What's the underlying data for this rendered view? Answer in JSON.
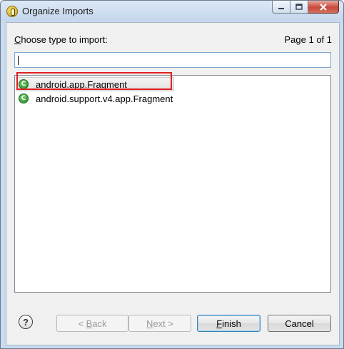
{
  "window": {
    "title": "Organize Imports",
    "controls": {
      "minimize_icon": "window-minimize-icon",
      "maximize_icon": "window-maximize-icon",
      "close_icon": "window-close-icon"
    }
  },
  "dialog": {
    "prompt_mnemonic": "C",
    "prompt_rest": "hoose type to import:",
    "page_indicator": "Page 1 of 1",
    "filter": {
      "value": "",
      "placeholder": ""
    }
  },
  "types": [
    {
      "label": "android.app.Fragment",
      "icon": "class-icon",
      "icon_glyph": "C",
      "selected": true
    },
    {
      "label": "android.support.v4.app.Fragment",
      "icon": "class-icon",
      "icon_glyph": "C",
      "selected": false
    }
  ],
  "buttons": {
    "help_glyph": "?",
    "back_prefix": "< ",
    "back_mnemonic": "B",
    "back_rest": "ack",
    "next_mnemonic": "N",
    "next_rest": "ext",
    "next_suffix": " >",
    "finish_mnemonic": "F",
    "finish_rest": "inish",
    "cancel": "Cancel"
  },
  "colors": {
    "highlight_border": "#e02020",
    "class_icon": "#2b8a2b",
    "title_bar": "#c4d6ec"
  }
}
